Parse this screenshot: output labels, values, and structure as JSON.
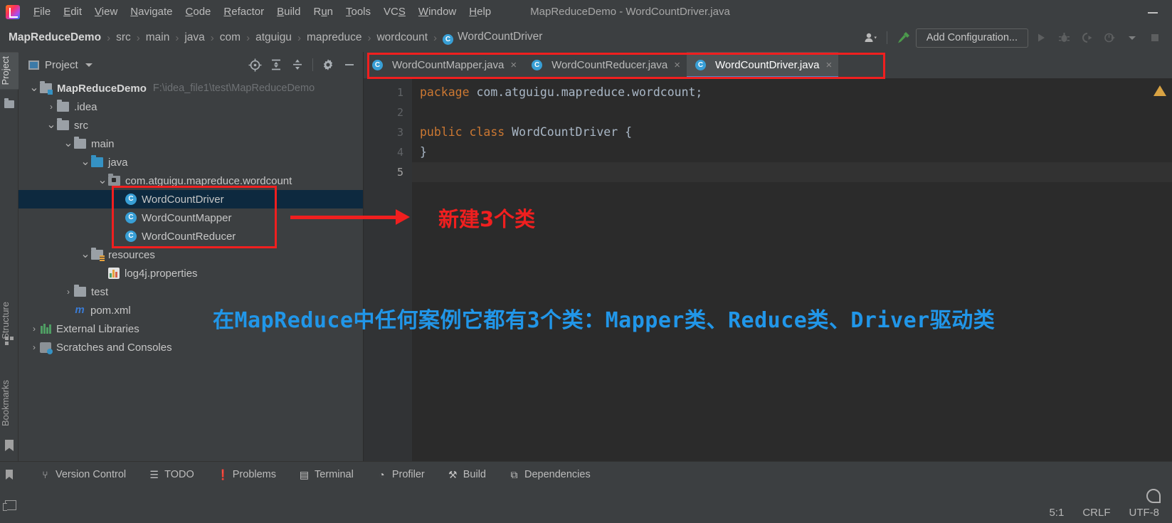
{
  "window": {
    "title": "MapReduceDemo - WordCountDriver.java",
    "minimize_label": "—"
  },
  "menu": {
    "items": [
      {
        "label": "File",
        "mnemonic": "F"
      },
      {
        "label": "Edit",
        "mnemonic": "E"
      },
      {
        "label": "View",
        "mnemonic": "V"
      },
      {
        "label": "Navigate",
        "mnemonic": "N"
      },
      {
        "label": "Code",
        "mnemonic": "C"
      },
      {
        "label": "Refactor",
        "mnemonic": "R"
      },
      {
        "label": "Build",
        "mnemonic": "B"
      },
      {
        "label": "Run",
        "mnemonic": "u"
      },
      {
        "label": "Tools",
        "mnemonic": "T"
      },
      {
        "label": "VCS",
        "mnemonic": "S"
      },
      {
        "label": "Window",
        "mnemonic": "W"
      },
      {
        "label": "Help",
        "mnemonic": "H"
      }
    ]
  },
  "navbar": {
    "crumbs": [
      "MapReduceDemo",
      "src",
      "main",
      "java",
      "com",
      "atguigu",
      "mapreduce",
      "wordcount"
    ],
    "current_file": "WordCountDriver",
    "current_file_badge": "C",
    "separator": "›",
    "add_configuration_label": "Add Configuration...",
    "icons": [
      "user-avatar-icon",
      "hammer-build-icon",
      "run-icon",
      "debug-icon",
      "run-with-coverage-icon",
      "profile-icon",
      "dropdown-icon",
      "stop-icon"
    ]
  },
  "tool_stripe": {
    "tabs": [
      "Project",
      "Structure",
      "Bookmarks"
    ],
    "active": "Project"
  },
  "project_panel": {
    "title": "Project",
    "toolbar_icons": [
      "locate-icon",
      "expand-all-icon",
      "collapse-all-icon",
      "gear-icon",
      "hide-icon"
    ],
    "tree": [
      {
        "label": "MapReduceDemo",
        "path": "F:\\idea_file1\\test\\MapReduceDemo",
        "indent": 0,
        "arrow": "⌄",
        "icon": "module-folder-icon",
        "bold": true
      },
      {
        "label": ".idea",
        "path": "",
        "indent": 1,
        "arrow": "›",
        "icon": "folder-icon",
        "bold": false
      },
      {
        "label": "src",
        "path": "",
        "indent": 1,
        "arrow": "⌄",
        "icon": "folder-icon",
        "bold": false
      },
      {
        "label": "main",
        "path": "",
        "indent": 2,
        "arrow": "⌄",
        "icon": "folder-icon",
        "bold": false
      },
      {
        "label": "java",
        "path": "",
        "indent": 3,
        "arrow": "⌄",
        "icon": "source-folder-icon",
        "bold": false
      },
      {
        "label": "com.atguigu.mapreduce.wordcount",
        "path": "",
        "indent": 4,
        "arrow": "⌄",
        "icon": "package-icon",
        "bold": false
      },
      {
        "label": "WordCountDriver",
        "path": "",
        "indent": 5,
        "arrow": "",
        "icon": "class-icon",
        "bold": false,
        "selected": true
      },
      {
        "label": "WordCountMapper",
        "path": "",
        "indent": 5,
        "arrow": "",
        "icon": "class-icon",
        "bold": false
      },
      {
        "label": "WordCountReducer",
        "path": "",
        "indent": 5,
        "arrow": "",
        "icon": "class-icon",
        "bold": false
      },
      {
        "label": "resources",
        "path": "",
        "indent": 3,
        "arrow": "⌄",
        "icon": "resources-folder-icon",
        "bold": false
      },
      {
        "label": "log4j.properties",
        "path": "",
        "indent": 4,
        "arrow": "",
        "icon": "properties-file-icon",
        "bold": false
      },
      {
        "label": "test",
        "path": "",
        "indent": 2,
        "arrow": "›",
        "icon": "folder-icon",
        "bold": false
      },
      {
        "label": "pom.xml",
        "path": "",
        "indent": 2,
        "arrow": "",
        "icon": "maven-icon",
        "bold": false
      },
      {
        "label": "External Libraries",
        "path": "",
        "indent": 0,
        "arrow": "›",
        "icon": "library-icon",
        "bold": false
      },
      {
        "label": "Scratches and Consoles",
        "path": "",
        "indent": 0,
        "arrow": "›",
        "icon": "scratch-icon",
        "bold": false
      }
    ]
  },
  "editor": {
    "tabs": [
      {
        "label": "WordCountMapper.java",
        "badge": "C",
        "active": false,
        "close": "×"
      },
      {
        "label": "WordCountReducer.java",
        "badge": "C",
        "active": false,
        "close": "×"
      },
      {
        "label": "WordCountDriver.java",
        "badge": "C",
        "active": true,
        "close": "×"
      }
    ],
    "line_numbers": [
      "1",
      "2",
      "3",
      "4",
      "5"
    ],
    "current_line": 5,
    "code_lines": [
      {
        "segments": [
          {
            "t": "package ",
            "c": "kw"
          },
          {
            "t": "com.atguigu.mapreduce.wordcount;",
            "c": "pl"
          }
        ]
      },
      {
        "segments": [
          {
            "t": "",
            "c": "pl"
          }
        ]
      },
      {
        "segments": [
          {
            "t": "public class ",
            "c": "kw"
          },
          {
            "t": "WordCountDriver {",
            "c": "pl"
          }
        ]
      },
      {
        "segments": [
          {
            "t": "}",
            "c": "pl"
          }
        ]
      },
      {
        "segments": [
          {
            "t": "",
            "c": "pl"
          }
        ]
      }
    ],
    "warning_icon": "warning-triangle-icon"
  },
  "bottom_toolbar": {
    "items": [
      {
        "label": "Version Control",
        "icon": "branch-icon",
        "glyph": "⑂"
      },
      {
        "label": "TODO",
        "icon": "todo-list-icon",
        "glyph": "☰"
      },
      {
        "label": "Problems",
        "icon": "problems-icon",
        "glyph": "❗"
      },
      {
        "label": "Terminal",
        "icon": "terminal-icon",
        "glyph": "▤"
      },
      {
        "label": "Profiler",
        "icon": "profiler-icon",
        "glyph": "◔"
      },
      {
        "label": "Build",
        "icon": "hammer-icon",
        "glyph": "⚒"
      },
      {
        "label": "Dependencies",
        "icon": "dependencies-icon",
        "glyph": "⧉"
      }
    ]
  },
  "status_bar": {
    "caret_position": "5:1",
    "line_separator": "CRLF",
    "encoding": "UTF-8",
    "ide_widget_icon": "notification-blob-icon",
    "layout_icon": "layout-toggle-icon"
  },
  "annotations": {
    "red_note": "新建3个类",
    "blue_note": "在MapReduce中任何案例它都有3个类：Mapper类、Reduce类、Driver驱动类",
    "red_color": "#f01f1f",
    "blue_color": "#2196e8"
  }
}
